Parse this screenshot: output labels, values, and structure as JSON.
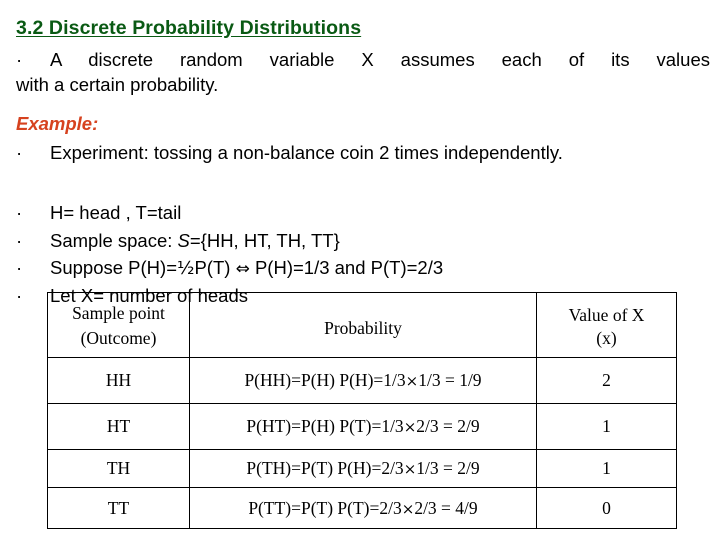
{
  "slide": {
    "title": "3.2 Discrete Probability Distributions",
    "title_color": "#0a5a14",
    "bullet_glyph": "·",
    "intro": {
      "line1": "A discrete random variable X assumes each of its values",
      "line2": "with a certain probability."
    },
    "example_label": "Example:",
    "example_label_color": "#d6421f",
    "experiment": {
      "line1": "Experiment:   tossing   a   non-balance   coin   2   times",
      "line2": "independently."
    },
    "bullets": {
      "heads_tails": "H= head ,  T=tail",
      "sample_space_prefix": "Sample space: ",
      "sample_space_symbol": "S",
      "sample_space_value": "={HH, HT, TH, TT}",
      "suppose_part1": "Suppose P(H)=",
      "suppose_half": "½",
      "suppose_part2": "P(T) ",
      "suppose_iff": "⇔",
      "suppose_part3": " P(H)=1/3  and P(T)=2/3",
      "let_x": "Let X= number of heads"
    }
  },
  "table": {
    "headers": {
      "sample_point": "Sample point",
      "sample_point_sub": "(Outcome)",
      "probability": "Probability",
      "value_of_x": "Value of X",
      "value_of_x_sub": "(x)"
    },
    "multiply_symbol": "×",
    "rows": [
      {
        "outcome": "HH",
        "prob_lead": "P(HH)=P(H) P(H)=1/3",
        "prob_tail": "1/3 = 1/9",
        "value": "2"
      },
      {
        "outcome": "HT",
        "prob_lead": "P(HT)=P(H) P(T)=1/3",
        "prob_tail": "2/3 = 2/9",
        "value": "1"
      },
      {
        "outcome": "TH",
        "prob_lead": "P(TH)=P(T) P(H)=2/3",
        "prob_tail": "1/3 = 2/9",
        "value": "1"
      },
      {
        "outcome": "TT",
        "prob_lead": "P(TT)=P(T) P(T)=2/3",
        "prob_tail": "2/3 = 4/9",
        "value": "0"
      }
    ]
  }
}
